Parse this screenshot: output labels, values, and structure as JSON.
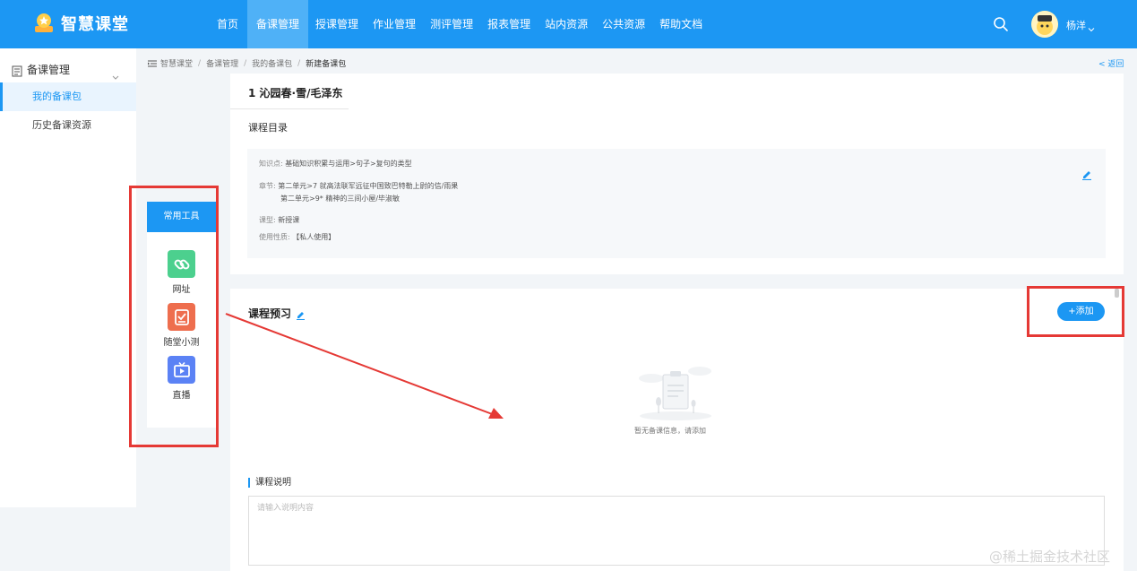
{
  "header": {
    "app_title": "智慧课堂",
    "nav": [
      "首页",
      "备课管理",
      "授课管理",
      "作业管理",
      "测评管理",
      "报表管理",
      "站内资源",
      "公共资源",
      "帮助文档"
    ],
    "active_nav": "备课管理",
    "username": "杨洋",
    "accent_color": "#1c97f3"
  },
  "sidebar": {
    "group_label": "备课管理",
    "items": [
      {
        "label": "我的备课包",
        "active": true
      },
      {
        "label": "历史备课资源",
        "active": false
      }
    ]
  },
  "tools": {
    "title": "常用工具",
    "items": [
      {
        "label": "网址",
        "icon": "link-icon",
        "color": "#4cd08e"
      },
      {
        "label": "随堂小测",
        "icon": "quiz-icon",
        "color": "#ee6e4e"
      },
      {
        "label": "直播",
        "icon": "tv-icon",
        "color": "#5b82f5"
      }
    ]
  },
  "breadcrumb": [
    "智慧课堂",
    "备课管理",
    "我的备课包",
    "新建备课包"
  ],
  "back_label": "< 返回",
  "lesson": {
    "title": "1 沁园春·雪/毛泽东",
    "catalog_label": "课程目录",
    "knowledge_key": "知识点:",
    "knowledge_val": "基础知识积累与运用>句子>复句的类型",
    "chapter_key": "章节:",
    "chapter_val_1": "第二单元>7 就高法联军远征中国致巴特勒上尉的信/雨果",
    "chapter_val_2": "第二单元>9* 精神的三间小屋/毕淑敏",
    "type_key": "课型:",
    "type_val": "新授课",
    "usage_key": "使用性质:",
    "usage_val": "【私人使用】"
  },
  "preview": {
    "title": "课程预习",
    "add_label": "+添加",
    "empty_text": "暂无备课信息，请添加"
  },
  "description": {
    "title": "课程说明",
    "placeholder": "请输入说明内容"
  },
  "watermark": "@稀土掘金技术社区",
  "annotation_color": "#e53935"
}
